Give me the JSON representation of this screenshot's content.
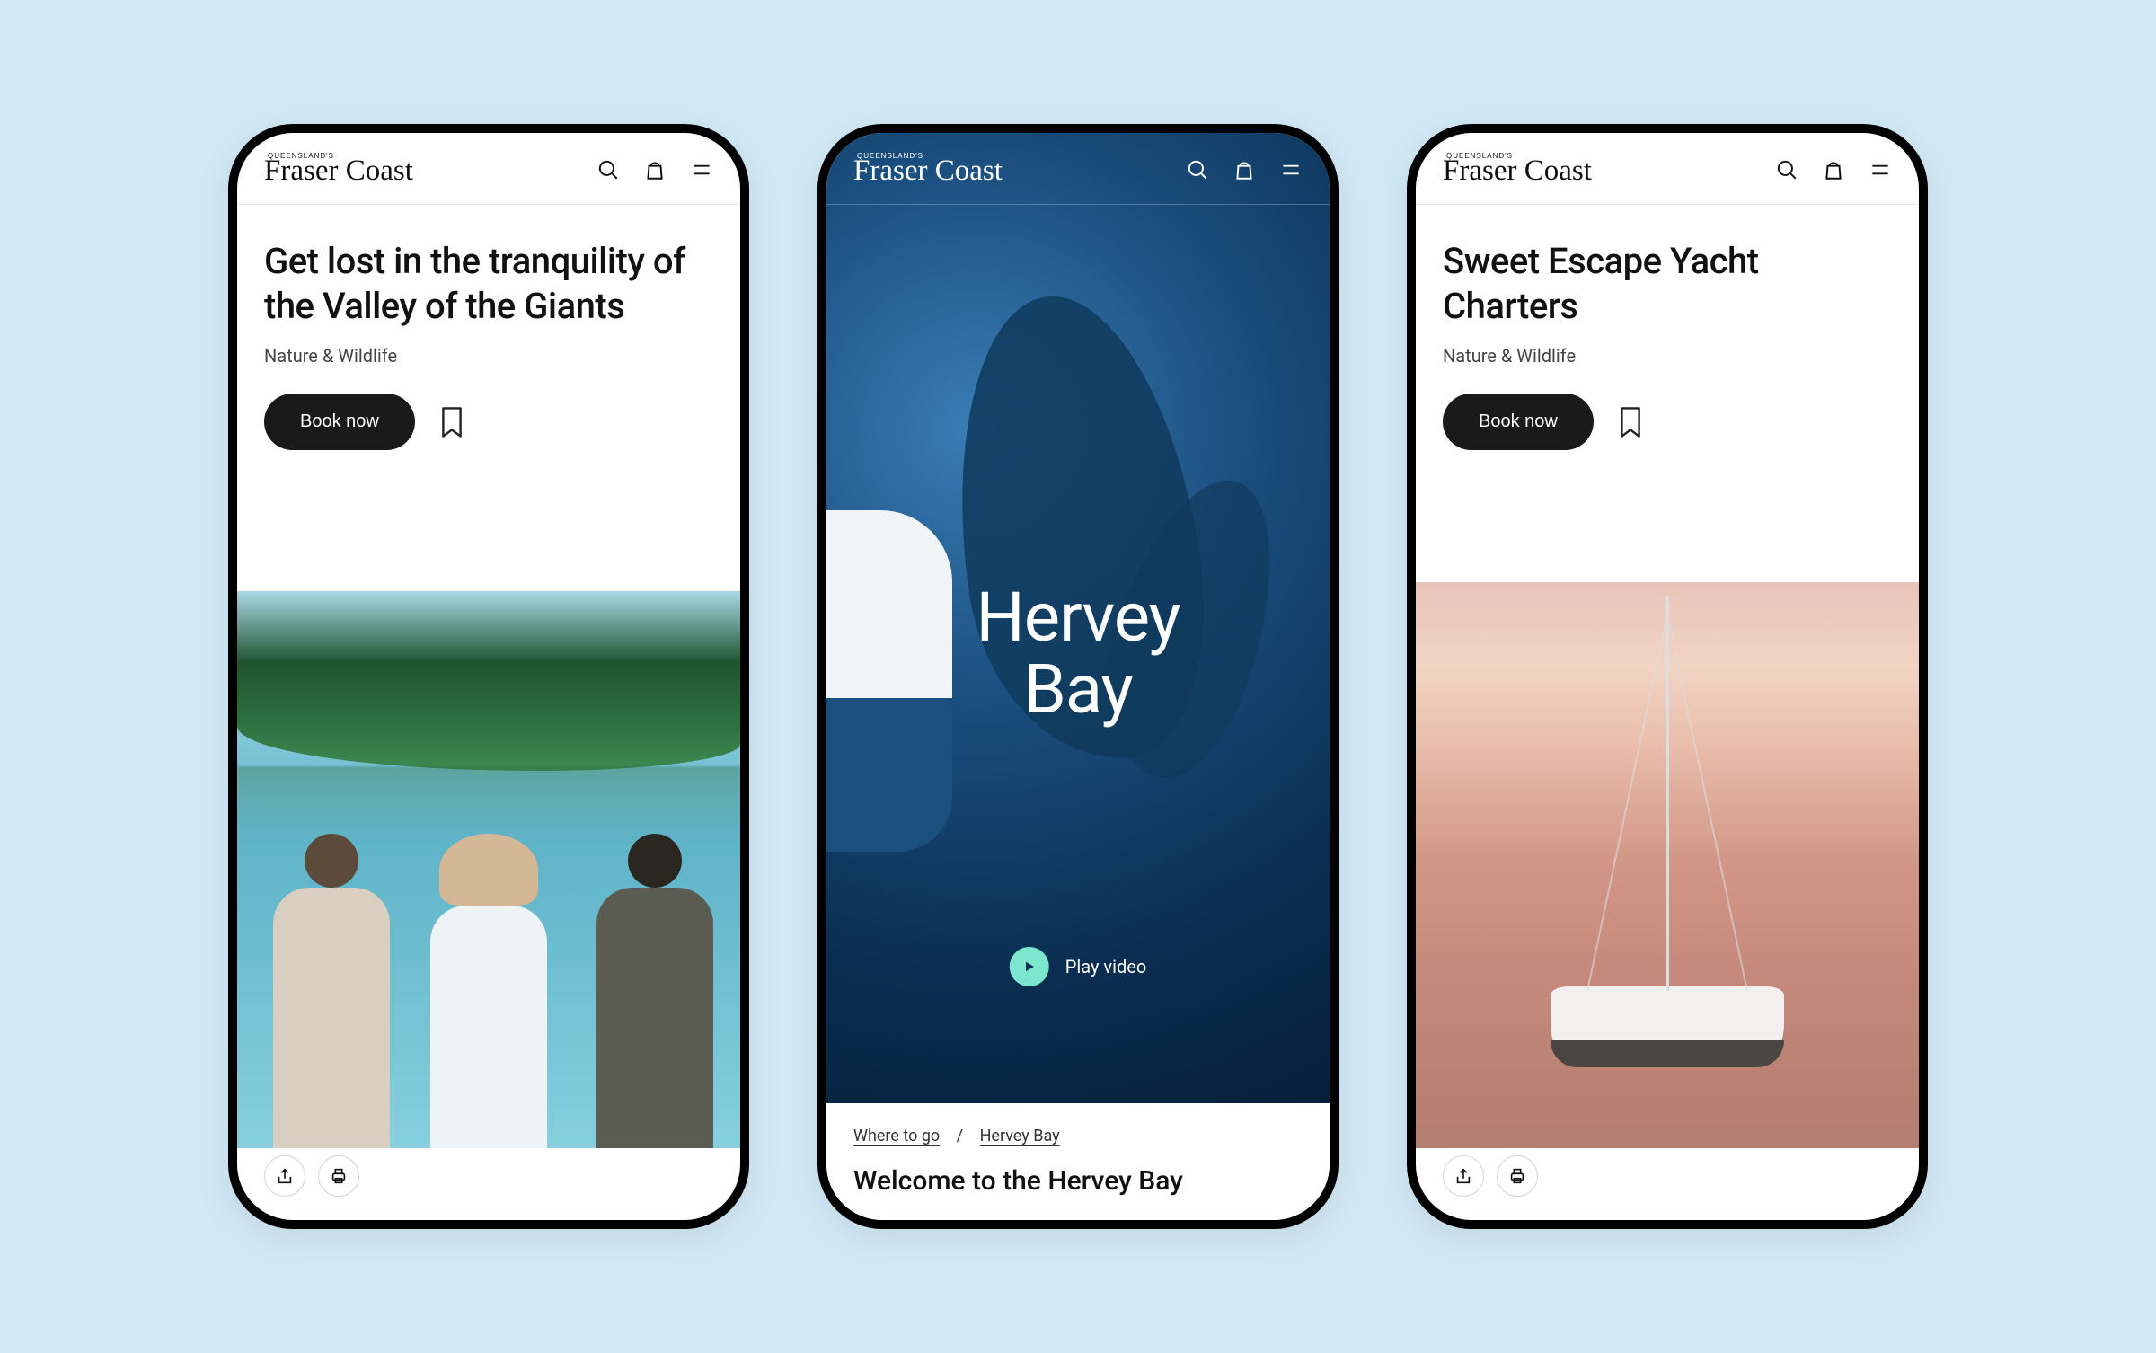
{
  "brand": {
    "tag": "QUEENSLAND'S",
    "name": "Fraser Coast"
  },
  "phone1": {
    "title": "Get lost in the tranquility of the Valley of the Giants",
    "category": "Nature & Wildlife",
    "cta": "Book now"
  },
  "phone2": {
    "hero_title": "Hervey\nBay",
    "play_label": "Play video",
    "breadcrumb": {
      "parent": "Where to go",
      "current": "Hervey Bay"
    },
    "welcome": "Welcome to the Hervey Bay"
  },
  "phone3": {
    "title": "Sweet Escape Yacht Charters",
    "category": "Nature & Wildlife",
    "cta": "Book now"
  }
}
